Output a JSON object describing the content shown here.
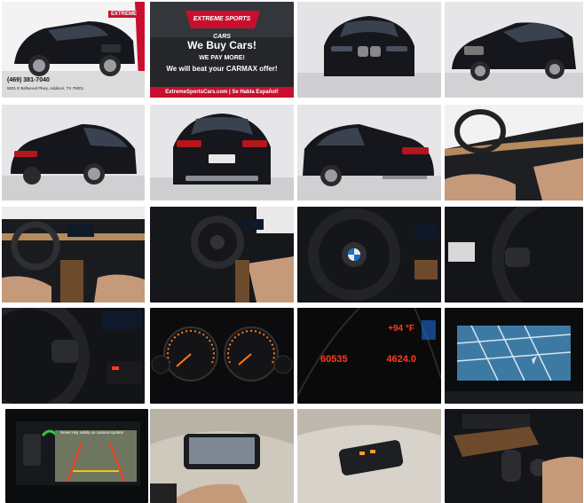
{
  "gallery": {
    "tiles": [
      {
        "id": "exterior-front-3q-dealer",
        "label": "Front three-quarter with dealer logo"
      },
      {
        "id": "we-buy-cars-ad",
        "label": "We Buy Cars promo"
      },
      {
        "id": "exterior-front",
        "label": "Front view"
      },
      {
        "id": "exterior-front-right",
        "label": "Front right view"
      },
      {
        "id": "exterior-rear-left",
        "label": "Rear left view"
      },
      {
        "id": "exterior-rear",
        "label": "Rear view"
      },
      {
        "id": "exterior-rear-right",
        "label": "Rear right view"
      },
      {
        "id": "interior-dash-side",
        "label": "Dashboard side view"
      },
      {
        "id": "interior-dash-wide",
        "label": "Dashboard wide"
      },
      {
        "id": "interior-driver",
        "label": "Driver seat view"
      },
      {
        "id": "steering-wheel",
        "label": "Steering wheel"
      },
      {
        "id": "steering-controls-right",
        "label": "Steering wheel right controls"
      },
      {
        "id": "steering-controls-left",
        "label": "Steering wheel left controls"
      },
      {
        "id": "gauge-cluster",
        "label": "Gauge cluster"
      },
      {
        "id": "odometer",
        "label": "Odometer"
      },
      {
        "id": "navigation",
        "label": "Navigation screen"
      },
      {
        "id": "backup-camera",
        "label": "Backup camera"
      },
      {
        "id": "sunroof",
        "label": "Sunroof"
      },
      {
        "id": "overhead-console",
        "label": "Overhead console"
      },
      {
        "id": "center-console",
        "label": "Center console"
      }
    ]
  },
  "dealer": {
    "phone": "(469) 381-7040",
    "address": "5001 E Beltwood Pkwy, Addison, TX 75001",
    "logo_text": "EXTREME"
  },
  "ad": {
    "logo": "EXTREME SPORTS CARS",
    "title": "We Buy Cars!",
    "pay_more": "WE PAY MORE!",
    "beat": "We will beat your CARMAX offer!",
    "footer": "ExtremeSportsCars.com  |  Se Habla Español!"
  },
  "odometer": {
    "temp": "+94 °F",
    "miles": "60535",
    "trip": "4624.0"
  },
  "camera": {
    "caution": "Never rely solely on camera system"
  },
  "colors": {
    "car_body": "#15171c",
    "leather": "#c49a7a",
    "dealer_red": "#c8102e",
    "backdrop_light": "#e6e6e8",
    "gauge_orange": "#ff7a1a",
    "display_red": "#ff3b1f"
  }
}
